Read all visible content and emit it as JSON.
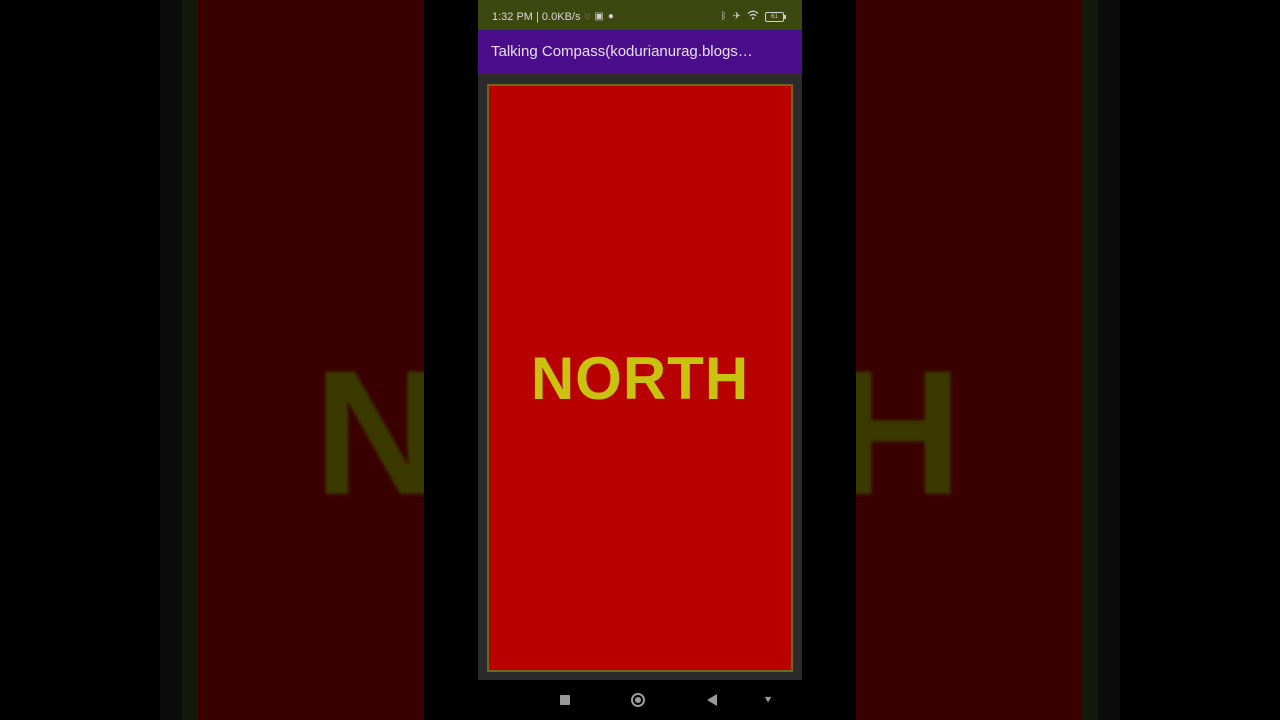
{
  "status_bar": {
    "time_speed": "1:32 PM | 0.0KB/s",
    "icons_left": [
      "whatsapp-icon",
      "youtube-icon",
      "notification-dot-icon"
    ],
    "icons_right": [
      "bluetooth-icon",
      "airplane-mode-icon",
      "wifi-icon",
      "battery-icon"
    ],
    "battery_level": "61"
  },
  "app_bar": {
    "title": "Talking Compass(kodurianurag.blogs…"
  },
  "compass": {
    "direction": "NORTH",
    "background_color": "#b80000",
    "text_color": "#c9c20e"
  },
  "nav_bar": {
    "buttons": [
      "recents-button",
      "home-button",
      "back-button",
      "assist-button"
    ]
  },
  "colors": {
    "status_bar": "#3b4810",
    "app_bar": "#4a0e8a"
  }
}
